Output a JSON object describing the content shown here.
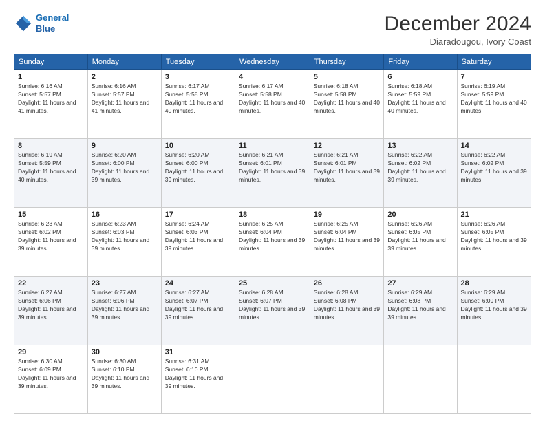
{
  "logo": {
    "line1": "General",
    "line2": "Blue"
  },
  "header": {
    "title": "December 2024",
    "subtitle": "Diaradougou, Ivory Coast"
  },
  "days_of_week": [
    "Sunday",
    "Monday",
    "Tuesday",
    "Wednesday",
    "Thursday",
    "Friday",
    "Saturday"
  ],
  "weeks": [
    [
      {
        "day": "1",
        "sunrise": "6:16 AM",
        "sunset": "5:57 PM",
        "daylight": "11 hours and 41 minutes."
      },
      {
        "day": "2",
        "sunrise": "6:16 AM",
        "sunset": "5:57 PM",
        "daylight": "11 hours and 41 minutes."
      },
      {
        "day": "3",
        "sunrise": "6:17 AM",
        "sunset": "5:58 PM",
        "daylight": "11 hours and 40 minutes."
      },
      {
        "day": "4",
        "sunrise": "6:17 AM",
        "sunset": "5:58 PM",
        "daylight": "11 hours and 40 minutes."
      },
      {
        "day": "5",
        "sunrise": "6:18 AM",
        "sunset": "5:58 PM",
        "daylight": "11 hours and 40 minutes."
      },
      {
        "day": "6",
        "sunrise": "6:18 AM",
        "sunset": "5:59 PM",
        "daylight": "11 hours and 40 minutes."
      },
      {
        "day": "7",
        "sunrise": "6:19 AM",
        "sunset": "5:59 PM",
        "daylight": "11 hours and 40 minutes."
      }
    ],
    [
      {
        "day": "8",
        "sunrise": "6:19 AM",
        "sunset": "5:59 PM",
        "daylight": "11 hours and 40 minutes."
      },
      {
        "day": "9",
        "sunrise": "6:20 AM",
        "sunset": "6:00 PM",
        "daylight": "11 hours and 39 minutes."
      },
      {
        "day": "10",
        "sunrise": "6:20 AM",
        "sunset": "6:00 PM",
        "daylight": "11 hours and 39 minutes."
      },
      {
        "day": "11",
        "sunrise": "6:21 AM",
        "sunset": "6:01 PM",
        "daylight": "11 hours and 39 minutes."
      },
      {
        "day": "12",
        "sunrise": "6:21 AM",
        "sunset": "6:01 PM",
        "daylight": "11 hours and 39 minutes."
      },
      {
        "day": "13",
        "sunrise": "6:22 AM",
        "sunset": "6:02 PM",
        "daylight": "11 hours and 39 minutes."
      },
      {
        "day": "14",
        "sunrise": "6:22 AM",
        "sunset": "6:02 PM",
        "daylight": "11 hours and 39 minutes."
      }
    ],
    [
      {
        "day": "15",
        "sunrise": "6:23 AM",
        "sunset": "6:02 PM",
        "daylight": "11 hours and 39 minutes."
      },
      {
        "day": "16",
        "sunrise": "6:23 AM",
        "sunset": "6:03 PM",
        "daylight": "11 hours and 39 minutes."
      },
      {
        "day": "17",
        "sunrise": "6:24 AM",
        "sunset": "6:03 PM",
        "daylight": "11 hours and 39 minutes."
      },
      {
        "day": "18",
        "sunrise": "6:25 AM",
        "sunset": "6:04 PM",
        "daylight": "11 hours and 39 minutes."
      },
      {
        "day": "19",
        "sunrise": "6:25 AM",
        "sunset": "6:04 PM",
        "daylight": "11 hours and 39 minutes."
      },
      {
        "day": "20",
        "sunrise": "6:26 AM",
        "sunset": "6:05 PM",
        "daylight": "11 hours and 39 minutes."
      },
      {
        "day": "21",
        "sunrise": "6:26 AM",
        "sunset": "6:05 PM",
        "daylight": "11 hours and 39 minutes."
      }
    ],
    [
      {
        "day": "22",
        "sunrise": "6:27 AM",
        "sunset": "6:06 PM",
        "daylight": "11 hours and 39 minutes."
      },
      {
        "day": "23",
        "sunrise": "6:27 AM",
        "sunset": "6:06 PM",
        "daylight": "11 hours and 39 minutes."
      },
      {
        "day": "24",
        "sunrise": "6:27 AM",
        "sunset": "6:07 PM",
        "daylight": "11 hours and 39 minutes."
      },
      {
        "day": "25",
        "sunrise": "6:28 AM",
        "sunset": "6:07 PM",
        "daylight": "11 hours and 39 minutes."
      },
      {
        "day": "26",
        "sunrise": "6:28 AM",
        "sunset": "6:08 PM",
        "daylight": "11 hours and 39 minutes."
      },
      {
        "day": "27",
        "sunrise": "6:29 AM",
        "sunset": "6:08 PM",
        "daylight": "11 hours and 39 minutes."
      },
      {
        "day": "28",
        "sunrise": "6:29 AM",
        "sunset": "6:09 PM",
        "daylight": "11 hours and 39 minutes."
      }
    ],
    [
      {
        "day": "29",
        "sunrise": "6:30 AM",
        "sunset": "6:09 PM",
        "daylight": "11 hours and 39 minutes."
      },
      {
        "day": "30",
        "sunrise": "6:30 AM",
        "sunset": "6:10 PM",
        "daylight": "11 hours and 39 minutes."
      },
      {
        "day": "31",
        "sunrise": "6:31 AM",
        "sunset": "6:10 PM",
        "daylight": "11 hours and 39 minutes."
      },
      null,
      null,
      null,
      null
    ]
  ]
}
